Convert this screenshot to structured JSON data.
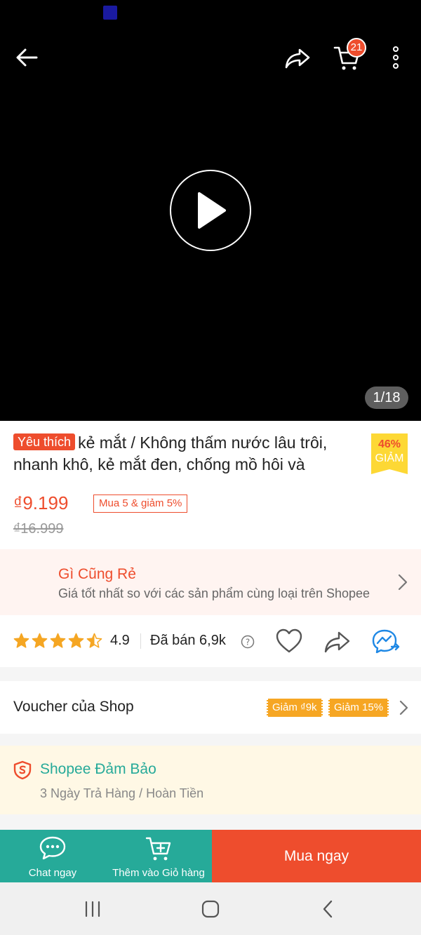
{
  "header": {
    "cart_count": "21"
  },
  "media": {
    "page_indicator": "1/18"
  },
  "product": {
    "badge": "Yêu thích",
    "title": "kẻ mắt / Không thấm nước lâu trôi, nhanh khô, kẻ mắt đen, chống mồ hôi và",
    "discount_percent": "46%",
    "discount_label": "GIẢM",
    "price": "₫9.199",
    "bundle_deal": "Mua 5 & giảm 5%",
    "original_price": "₫16.999"
  },
  "cheap_banner": {
    "title": "Gì Cũng Rẻ",
    "subtitle": "Giá tốt nhất so với các sản phẩm cùng loại trên Shopee"
  },
  "rating": {
    "stars": 4.5,
    "value": "4.9",
    "sold": "Đã bán 6,9k"
  },
  "voucher": {
    "title": "Voucher của Shop",
    "tags": [
      "Giảm ₫9k",
      "Giảm 15%"
    ]
  },
  "guarantee": {
    "title": "Shopee Đảm Bảo",
    "subtitle": "3 Ngày Trả Hàng / Hoàn Tiền"
  },
  "bottom_bar": {
    "chat_label": "Chat ngay",
    "add_to_cart_label": "Thêm vào Giỏ hàng",
    "buy_label": "Mua ngay"
  },
  "colors": {
    "brand": "#ee4d2d",
    "teal": "#26aa99",
    "voucher": "#f6a623",
    "star": "#f5a623"
  },
  "icons": [
    "back-arrow-icon",
    "share-icon",
    "cart-icon",
    "more-vertical-icon",
    "play-icon",
    "chevron-right-icon",
    "star-icon",
    "help-icon",
    "heart-icon",
    "messenger-icon",
    "shield-icon",
    "chat-icon",
    "add-cart-icon"
  ]
}
